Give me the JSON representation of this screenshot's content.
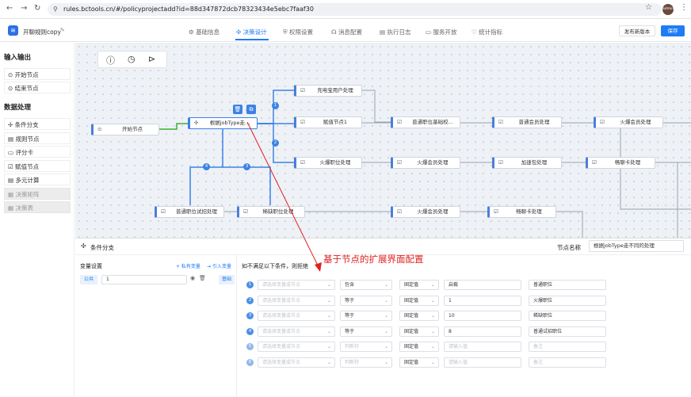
{
  "browser": {
    "url": "rules.bctools.cn/#/policyprojectadd?id=88d347872dcb78323434e5ebc7faaf30",
    "avatar": "admin"
  },
  "app": {
    "title": "开聊规则copy",
    "tabs": [
      "基础信息",
      "决策设计",
      "权限设置",
      "消息配置",
      "执行日志",
      "服务开放",
      "统计指标"
    ],
    "publish_label": "发布新版本",
    "save_label": "保存"
  },
  "sidebar": {
    "section1": "输入输出",
    "io_items": [
      "开始节点",
      "结束节点"
    ],
    "section2": "数据处理",
    "proc_items": [
      {
        "label": "条件分支",
        "disabled": false
      },
      {
        "label": "规则节点",
        "disabled": false
      },
      {
        "label": "评分卡",
        "disabled": false
      },
      {
        "label": "赋值节点",
        "disabled": false
      },
      {
        "label": "多元计算",
        "disabled": false
      },
      {
        "label": "决策矩阵",
        "disabled": true
      },
      {
        "label": "决策表",
        "disabled": true
      }
    ]
  },
  "canvas": {
    "nodes": {
      "start": "开始节点",
      "branch": "根据jobType走...",
      "top1": "充电宝用户处理",
      "mid1": "赋值节点1",
      "mid2": "普通职位基础校...",
      "mid3": "普通会员处理",
      "mid4": "火爆会员处理",
      "row3a": "火爆职位处理",
      "row3b": "火爆会员处理",
      "row3c": "加速包处理",
      "row3d": "畅聊卡处理",
      "row4a": "普通职位试招处理",
      "row4b": "稀缺职位处理",
      "row4c": "火爆会员处理",
      "row4d": "畅聊卡处理"
    },
    "badges": [
      "1",
      "2",
      "3",
      "4"
    ]
  },
  "annotation": "基于节点的扩展界面配置",
  "panel": {
    "title": "条件分支",
    "node_name_label": "节点名称",
    "node_name_value": "根据jobType走不同的处理",
    "var_header": "变量设置",
    "add_private": "+ 私有变量",
    "import_var": "引入变量",
    "var_scope": "公共",
    "var_value": "1",
    "var_type": "基础",
    "cond_header": "如不满足以下条件，则拒绝",
    "var_placeholder": "请选择变量或节点",
    "input_placeholder": "请输入值",
    "rows": [
      {
        "num": "1",
        "op": "包含",
        "mode": "固定值",
        "value": "启裁",
        "target": "普通职位",
        "ph": false
      },
      {
        "num": "2",
        "op": "等于",
        "mode": "固定值",
        "value": "1",
        "target": "火爆职位",
        "ph": false
      },
      {
        "num": "3",
        "op": "等于",
        "mode": "固定值",
        "value": "10",
        "target": "稀缺职位",
        "ph": false
      },
      {
        "num": "4",
        "op": "等于",
        "mode": "固定值",
        "value": "8",
        "target": "普通试招职位",
        "ph": false
      },
      {
        "num": "5",
        "op": "判断符",
        "mode": "固定值",
        "value": "请输入值",
        "target": "备注",
        "ph": true
      },
      {
        "num": "6",
        "op": "判断符",
        "mode": "固定值",
        "value": "请输入值",
        "target": "备注",
        "ph": true
      }
    ]
  },
  "colors": {
    "accent": "#1f7cf5",
    "annotation": "#e02020",
    "canvas_bg": "#eef1f6"
  }
}
